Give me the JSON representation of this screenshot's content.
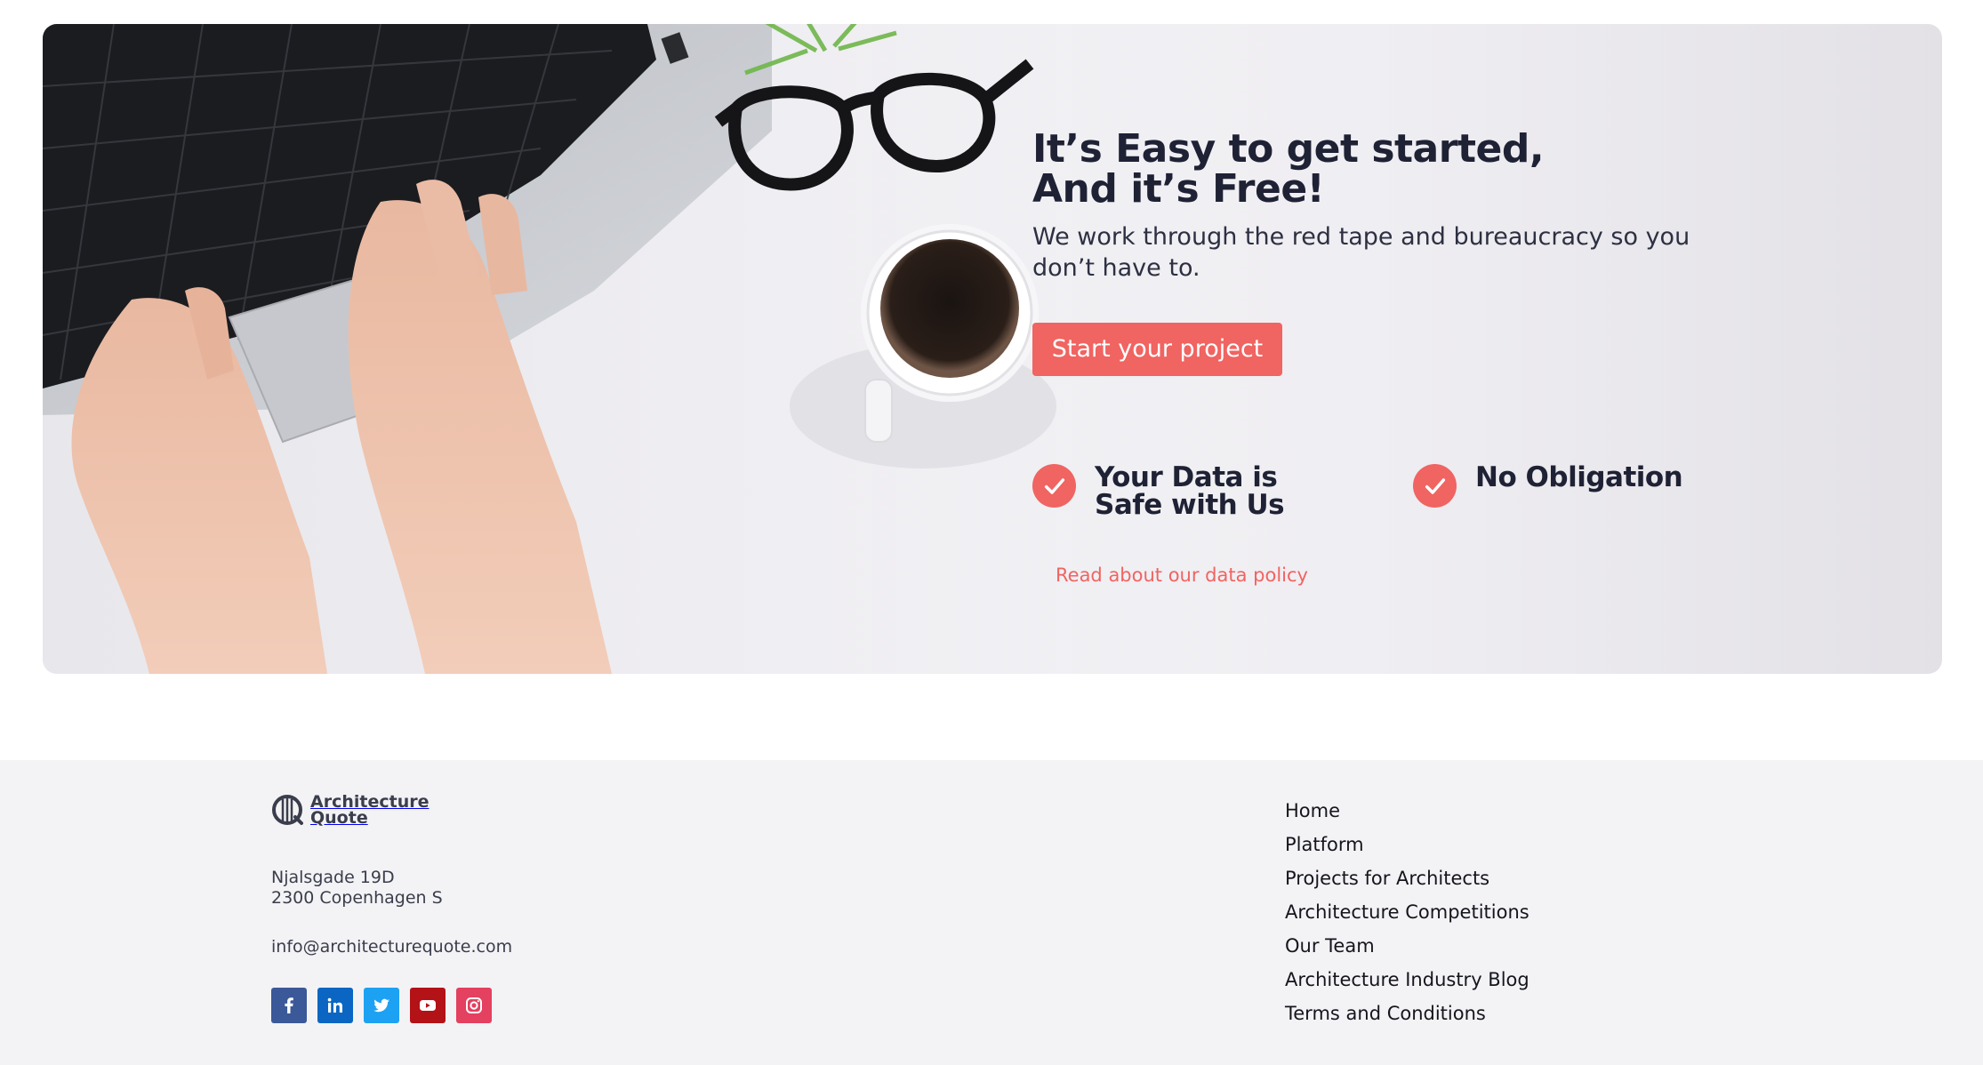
{
  "hero": {
    "title_line1": "It’s Easy to get started,",
    "title_line2": "And it’s Free!",
    "subtitle": "We work through the red tape and bureaucracy so you don’t have to.",
    "cta_label": "Start your project",
    "features": [
      {
        "title_line1": "Your Data is",
        "title_line2": "Safe with Us",
        "link": "Read about our data policy"
      },
      {
        "title_line1": "No Obligation",
        "title_line2": ""
      }
    ]
  },
  "footer": {
    "logo": {
      "line1": "Architecture",
      "line2": "Quote"
    },
    "address": {
      "line1": "Njalsgade 19D",
      "line2": "2300 Copenhagen S"
    },
    "email": "info@architecturequote.com",
    "socials": [
      {
        "icon": "facebook-icon",
        "color": "#3b5998"
      },
      {
        "icon": "linkedin-icon",
        "color": "#0a66c2"
      },
      {
        "icon": "twitter-icon",
        "color": "#1da1f2"
      },
      {
        "icon": "youtube-icon",
        "color": "#b31217"
      },
      {
        "icon": "instagram-icon",
        "color": "#e4405f"
      }
    ],
    "nav": [
      "Home",
      "Platform",
      "Projects for Architects",
      "Architecture Competitions",
      "Our Team",
      "Architecture Industry Blog",
      "Terms and Conditions"
    ]
  },
  "colors": {
    "accent": "#f06461",
    "text_dark": "#1f2235",
    "footer_bg": "#f3f3f6"
  }
}
